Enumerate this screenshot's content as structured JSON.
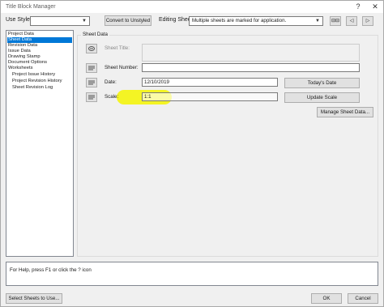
{
  "window": {
    "title": "Title Block Manager",
    "help_glyph": "?",
    "close_glyph": "✕"
  },
  "toolbar": {
    "use_style_label": "Use Style:",
    "use_style_value": "",
    "convert_button": "Convert to Unstyled",
    "editing_sheet_label": "Editing Sheet:",
    "editing_sheet_value": "Multiple sheets are marked for application.",
    "btn1_glyph": "⊟⊟",
    "btn2_glyph": "◁",
    "btn3_glyph": "▷"
  },
  "tree": {
    "items": [
      {
        "label": "Project Data",
        "selected": false,
        "indent": false
      },
      {
        "label": "Sheet Data",
        "selected": true,
        "indent": false
      },
      {
        "label": "Revision Data",
        "selected": false,
        "indent": false
      },
      {
        "label": "Issue Data",
        "selected": false,
        "indent": false
      },
      {
        "label": "Drawing Stamp",
        "selected": false,
        "indent": false
      },
      {
        "label": "Document Options",
        "selected": false,
        "indent": false
      },
      {
        "label": "Worksheets",
        "selected": false,
        "indent": false
      },
      {
        "label": "Project Issue History",
        "selected": false,
        "indent": true
      },
      {
        "label": "Project Revision History",
        "selected": false,
        "indent": true
      },
      {
        "label": "Sheet Revision Log",
        "selected": false,
        "indent": true
      }
    ]
  },
  "sheet_data": {
    "group_title": "Sheet Data",
    "sheet_title_label": "Sheet Title:",
    "sheet_title_value": "",
    "sheet_number_label": "Sheet Number:",
    "sheet_number_value": "",
    "date_label": "Date:",
    "date_value": "12/10/2019",
    "todays_date_button": "Today's Date",
    "scale_label": "Scale:",
    "scale_value": "1:1",
    "update_scale_button": "Update Scale",
    "manage_button": "Manage Sheet Data..."
  },
  "status": {
    "text": "For Help, press F1 or click the ? icon"
  },
  "footer": {
    "select_sheets_button": "Select Sheets to Use...",
    "ok_button": "OK",
    "cancel_button": "Cancel"
  },
  "colors": {
    "selection": "#0078d7",
    "highlighter": "#f5f500",
    "dialog_bg": "#f0f0f0"
  }
}
